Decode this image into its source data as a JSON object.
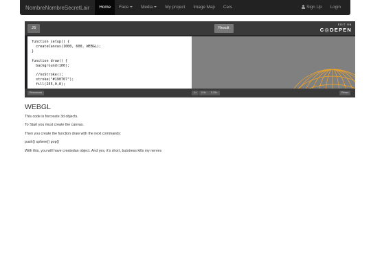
{
  "navbar": {
    "brand": "NombreNombreSecretLair",
    "items": [
      {
        "label": "Home",
        "active": true
      },
      {
        "label": "Face",
        "dropdown": true
      },
      {
        "label": "Media",
        "dropdown": true
      },
      {
        "label": "My project"
      },
      {
        "label": "Image Map"
      },
      {
        "label": "Cars"
      }
    ],
    "signup_label": "Sign Up",
    "login_label": "Login"
  },
  "embed": {
    "tab_js": "JS",
    "tab_result": "Result",
    "edit_on": "EDIT ON",
    "codepen": "C◎DEPEN",
    "code": "function setup() {\n  createCanvas(1000, 600, WEBGL);\n}\n\nfunction draw() {\n  background(100);\n\n  //noStroke();\n  stroke(\"#190707\");\n  fill(255,0,0);",
    "footer": {
      "resources_label": "Resources",
      "zoom_1x": "1×",
      "zoom_05x": "0.5×",
      "zoom_025x": "0.25×",
      "rerun_label": "Rerun"
    },
    "sphere_color": "#f5a623",
    "result_bg": "#808080"
  },
  "article": {
    "title": "WEBGL",
    "paragraphs": [
      "This code is forcreate 3d objects.",
      "To Start you must create the canvas.",
      "Then you create the function draw with the next commands:",
      "push() sphere() pop()",
      "With this, you will have createdan object. And yes, it's short, butstress kills my nerves"
    ]
  }
}
